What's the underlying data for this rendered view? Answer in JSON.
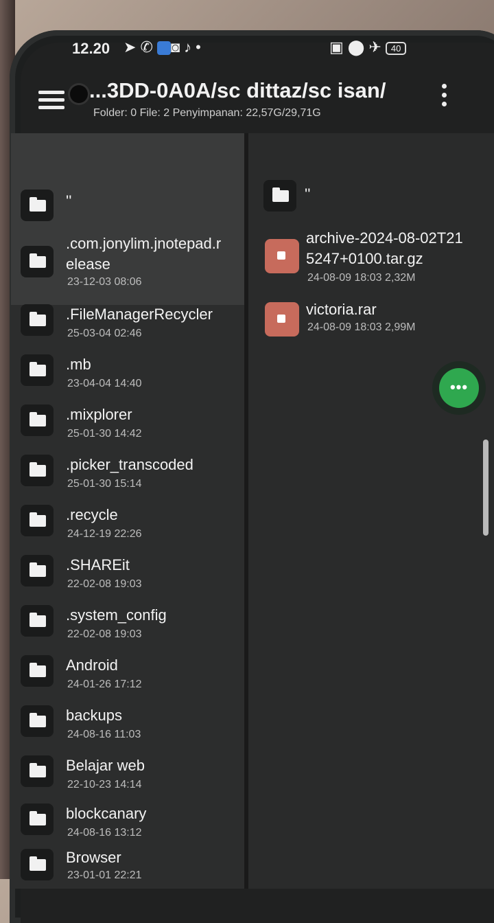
{
  "status_bar": {
    "time": "12.20",
    "left_icons": [
      "telegram-icon",
      "whatsapp-icon",
      "facebook-icon",
      "instagram-icon",
      "music-icon",
      "dot-icon"
    ],
    "right_icons": [
      "nfc-icon",
      "location-icon",
      "airplane-icon"
    ],
    "battery": "40"
  },
  "toolbar": {
    "path": "...3DD-0A0A/sc dittaz/sc isan/",
    "info": "Folder: 0  File: 2  Penyimpanan: 22,57G/29,71G"
  },
  "left_pane": {
    "up_label": "''",
    "items": [
      {
        "name": ".com.jonylim.jnotepad.r",
        "name2": "elease",
        "meta": "23-12-03 08:06"
      },
      {
        "name": ".FileManagerRecycler",
        "meta": "25-03-04 02:46"
      },
      {
        "name": ".mb",
        "meta": "23-04-04 14:40"
      },
      {
        "name": ".mixplorer",
        "meta": "25-01-30 14:42"
      },
      {
        "name": ".picker_transcoded",
        "meta": "25-01-30 15:14"
      },
      {
        "name": ".recycle",
        "meta": "24-12-19 22:26"
      },
      {
        "name": ".SHAREit",
        "meta": "22-02-08 19:03"
      },
      {
        "name": ".system_config",
        "meta": "22-02-08 19:03"
      },
      {
        "name": "Android",
        "meta": "24-01-26 17:12"
      },
      {
        "name": "backups",
        "meta": "24-08-16 11:03"
      },
      {
        "name": "Belajar web",
        "meta": "22-10-23 14:14"
      },
      {
        "name": "blockcanary",
        "meta": "24-08-16 13:12"
      },
      {
        "name": "Browser",
        "meta": "23-01-01 22:21"
      }
    ]
  },
  "right_pane": {
    "up_label": "''",
    "items": [
      {
        "name": "archive-2024-08-02T21",
        "name2": "5247+0100.tar.gz",
        "meta": "24-08-09 18:03  2,32M"
      },
      {
        "name": "victoria.rar",
        "meta": "24-08-09 18:03  2,99M"
      }
    ]
  },
  "fab": {
    "label": "•••",
    "color": "#2fa84f"
  }
}
